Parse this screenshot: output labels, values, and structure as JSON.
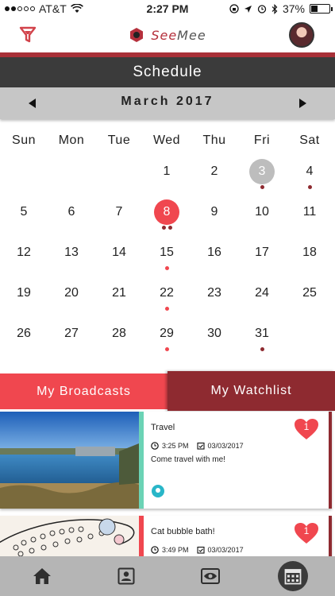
{
  "status_bar": {
    "carrier": "AT&T",
    "time": "2:27 PM",
    "battery": "37%",
    "battery_level": 0.37,
    "signal_bars_filled": 2,
    "signal_bars_total": 5
  },
  "header": {
    "logo_see": "See",
    "logo_mee": "Mee",
    "icons": {
      "filter": "filter-icon",
      "avatar": "avatar"
    }
  },
  "schedule_title": "Schedule",
  "calendar": {
    "month_label": "March 2017",
    "weekdays": [
      "Sun",
      "Mon",
      "Tue",
      "Wed",
      "Thu",
      "Fri",
      "Sat"
    ],
    "first_weekday_index": 3,
    "days_in_month": 31,
    "today": 8,
    "selected": 3,
    "events": {
      "3": [
        "#8e2a30"
      ],
      "4": [
        "#8e2a30"
      ],
      "8": [
        "#8e2a30",
        "#8e2a30"
      ],
      "15": [
        "#f0474f"
      ],
      "22": [
        "#f0474f"
      ],
      "29": [
        "#f0474f"
      ],
      "31": [
        "#8e2a30"
      ]
    }
  },
  "tabs": {
    "broadcasts": "My Broadcasts",
    "watchlist": "My Watchlist",
    "active": "watchlist"
  },
  "cards": [
    {
      "title": "Travel",
      "time": "3:25 PM",
      "date": "03/03/2017",
      "description": "Come travel with me!",
      "likes": "1",
      "stripe_color": "#6bd3b5",
      "has_location_pin": true,
      "thumb": "harbor-photo"
    },
    {
      "title": "Cat bubble bath!",
      "time": "3:49 PM",
      "date": "03/03/2017",
      "description": "",
      "likes": "1",
      "stripe_color": "#f0474f",
      "has_location_pin": false,
      "thumb": "drawing-photo"
    }
  ],
  "bottom_nav": [
    {
      "name": "home-icon"
    },
    {
      "name": "profile-icon"
    },
    {
      "name": "eye-icon"
    },
    {
      "name": "calendar-icon",
      "active": true
    }
  ],
  "colors": {
    "accent_red": "#f0474f",
    "dark_red": "#8e2a30",
    "header_gray": "#3b3b3b",
    "month_bar_gray": "#c6c6c6",
    "nav_gray": "#b5b5b5"
  }
}
